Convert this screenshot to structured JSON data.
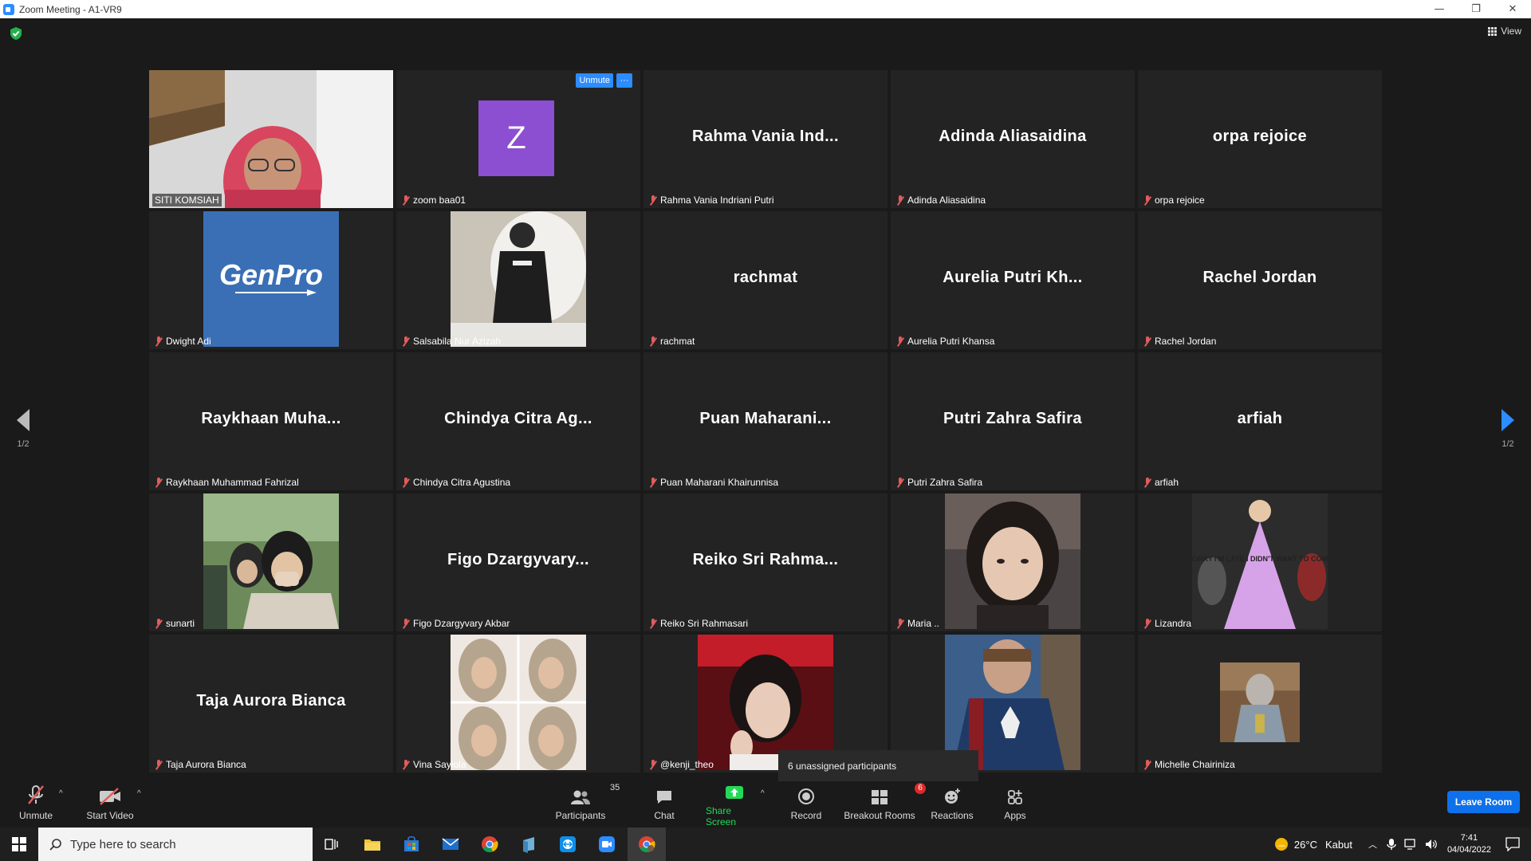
{
  "window": {
    "title": "Zoom Meeting - A1-VR9",
    "controls": [
      "—",
      "❐",
      "✕"
    ]
  },
  "header": {
    "view_label": "View"
  },
  "pager": {
    "left_page": "1/2",
    "right_page": "1/2"
  },
  "tiles": [
    {
      "name": "SITI KOMSIAH",
      "big": "",
      "type": "photo"
    },
    {
      "name": "zoom baa01",
      "big": "",
      "type": "avatar",
      "avatar_letter": "Z"
    },
    {
      "name": "Rahma Vania Indriani Putri",
      "big": "Rahma Vania Ind...",
      "type": "name"
    },
    {
      "name": "Adinda Aliasaidina",
      "big": "Adinda Aliasaidina",
      "type": "name"
    },
    {
      "name": "orpa rejoice",
      "big": "orpa rejoice",
      "type": "name"
    },
    {
      "name": "Dwight Adi",
      "big": "",
      "type": "photo"
    },
    {
      "name": "Salsabila Nur Azizah",
      "big": "",
      "type": "photo"
    },
    {
      "name": "rachmat",
      "big": "rachmat",
      "type": "name"
    },
    {
      "name": "Aurelia Putri Khansa",
      "big": "Aurelia Putri Kh...",
      "type": "name"
    },
    {
      "name": "Rachel Jordan",
      "big": "Rachel Jordan",
      "type": "name"
    },
    {
      "name": "Raykhaan Muhammad Fahrizal",
      "big": "Raykhaan  Muha...",
      "type": "name"
    },
    {
      "name": "Chindya Citra Agustina",
      "big": "Chindya Citra Ag...",
      "type": "name"
    },
    {
      "name": "Puan Maharani Khairunnisa",
      "big": "Puan  Maharani...",
      "type": "name"
    },
    {
      "name": "Putri Zahra Safira",
      "big": "Putri Zahra Safira",
      "type": "name"
    },
    {
      "name": "arfiah",
      "big": "arfiah",
      "type": "name"
    },
    {
      "name": "sunarti",
      "big": "",
      "type": "photo"
    },
    {
      "name": "Figo Dzargyvary Akbar",
      "big": "Figo  Dzargyvary...",
      "type": "name"
    },
    {
      "name": "Reiko Sri Rahmasari",
      "big": "Reiko  Sri  Rahma...",
      "type": "name"
    },
    {
      "name": "Maria ..",
      "big": "",
      "type": "photo"
    },
    {
      "name": "Lizandra",
      "big": "",
      "type": "photo"
    },
    {
      "name": "Taja Aurora Bianca",
      "big": "Taja Aurora Bianca",
      "type": "name"
    },
    {
      "name": "Vina Sayiola",
      "big": "",
      "type": "photo"
    },
    {
      "name": "@kenji_theo",
      "big": "",
      "type": "photo"
    },
    {
      "name": "",
      "big": "",
      "type": "photo"
    },
    {
      "name": "Michelle Chairiniza",
      "big": "",
      "type": "photo"
    }
  ],
  "tile_actions": {
    "unmute": "Unmute",
    "more": "···"
  },
  "genpro_logo_text": "GenPro",
  "lizandra_dress_text": "SORRY I'M LATE I DIDN'T WANT TO COME",
  "tooltip": "6 unassigned participants",
  "toolbar": {
    "unmute": "Unmute",
    "start_video": "Start Video",
    "participants": "Participants",
    "participants_count": "35",
    "chat": "Chat",
    "share_screen": "Share Screen",
    "record": "Record",
    "breakout_rooms": "Breakout Rooms",
    "breakout_badge": "6",
    "reactions": "Reactions",
    "apps": "Apps",
    "leave_room": "Leave Room"
  },
  "taskbar": {
    "search_placeholder": "Type here to search",
    "weather_temp": "26°C",
    "weather_desc": "Kabut",
    "time": "7:41",
    "date": "04/04/2022"
  },
  "colors": {
    "accent": "#2d8cff",
    "active_speaker": "#d6f33b",
    "share_green": "#23d959",
    "muted_red": "#e25c5c"
  }
}
